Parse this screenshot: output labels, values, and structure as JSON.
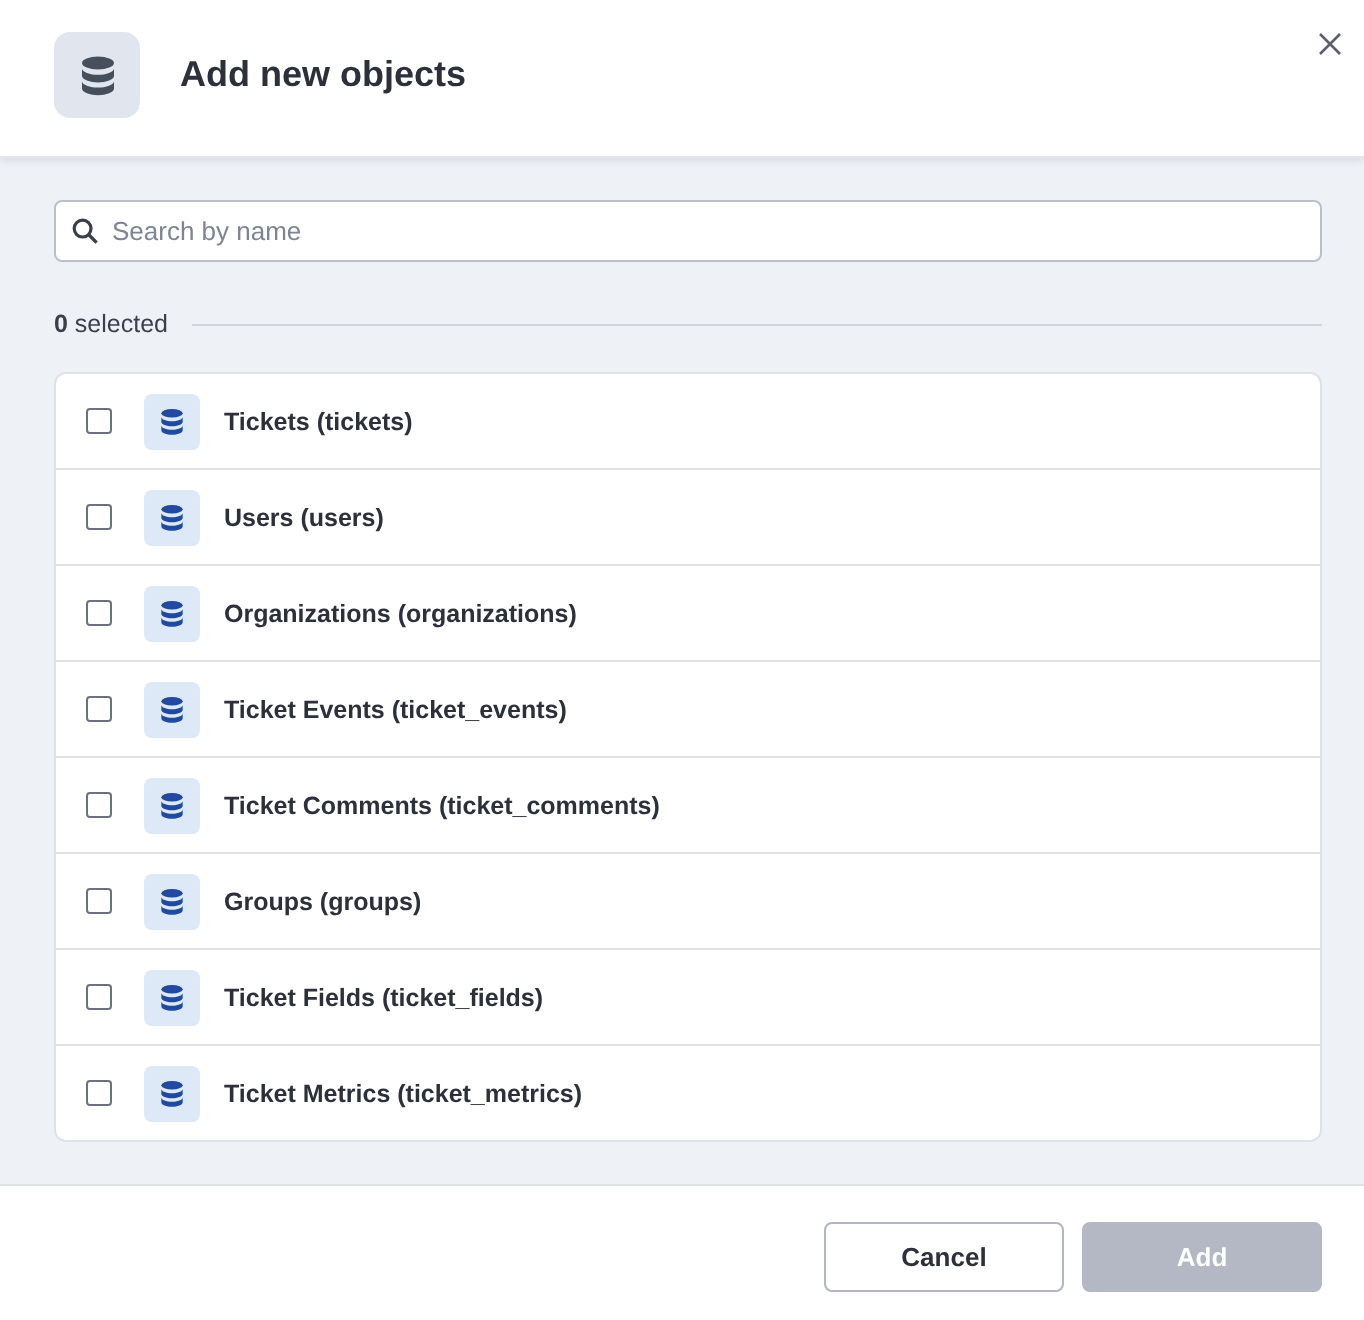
{
  "dialog": {
    "title": "Add new objects"
  },
  "search": {
    "placeholder": "Search by name"
  },
  "selection": {
    "summary": "**0** selected"
  },
  "objects": [
    {
      "label": "Tickets (tickets)",
      "checked": false
    },
    {
      "label": "Users (users)",
      "checked": false
    },
    {
      "label": "Organizations (organizations)",
      "checked": false
    },
    {
      "label": "Ticket Events (ticket_events)",
      "checked": false
    },
    {
      "label": "Ticket Comments (ticket_comments)",
      "checked": false
    },
    {
      "label": "Groups (groups)",
      "checked": false
    },
    {
      "label": "Ticket Fields (ticket_fields)",
      "checked": false
    },
    {
      "label": "Ticket Metrics (ticket_metrics)",
      "checked": false
    }
  ],
  "buttons": [
    {
      "label": "Cancel",
      "kind": "secondary",
      "disabled": false
    },
    {
      "label": "Add",
      "kind": "primary",
      "disabled": true
    }
  ]
}
